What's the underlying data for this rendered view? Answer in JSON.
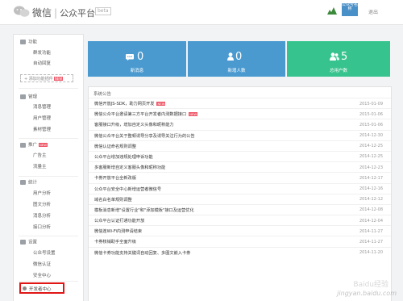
{
  "header": {
    "brand": "微信",
    "platform": "公众平台",
    "beta": "beta",
    "account_name": "公众号名称",
    "logout": "退出"
  },
  "sidebar": {
    "groups": [
      {
        "label": "功能",
        "items": [
          "群发功能",
          "自动回复"
        ]
      },
      {
        "label": "管理",
        "items": [
          "消息管理",
          "用户管理",
          "素材管理"
        ]
      },
      {
        "label": "推广",
        "items": [
          "广告主",
          "流量主"
        ]
      },
      {
        "label": "统计",
        "items": [
          "用户分析",
          "图文分析",
          "消息分析",
          "接口分析"
        ]
      },
      {
        "label": "设置",
        "items": [
          "公众号设置",
          "微信认证",
          "安全中心"
        ]
      }
    ],
    "add_function": "+ 添加功能插件",
    "add_function_badge": "NEW",
    "promo_badge": "NEW",
    "dev_center": "开发者中心"
  },
  "stats": {
    "new_messages": {
      "value": "0",
      "label": "新消息"
    },
    "new_users": {
      "value": "0",
      "label": "新增人数"
    },
    "total_users": {
      "value": "5",
      "label": "总用户数"
    }
  },
  "announcements": {
    "title": "系统公告",
    "items": [
      {
        "text": "微信开放JS-SDK，助力网页开发",
        "new": true,
        "date": "2015-01-09"
      },
      {
        "text": "微信公众平台邀请第三方平台开发者内测数据接口",
        "new": true,
        "date": "2015-01-06"
      },
      {
        "text": "客服接口升级，增加自定义头像和昵称能力",
        "new": false,
        "date": "2015-01-06"
      },
      {
        "text": "微信公众平台关于整顿诱导分享及诱导关注行为的公告",
        "new": false,
        "date": "2014-12-30"
      },
      {
        "text": "微信认证命名规则调整",
        "new": false,
        "date": "2014-12-25"
      },
      {
        "text": "公众平台增加违规处理申诉功能",
        "new": false,
        "date": "2014-12-25"
      },
      {
        "text": "多客服新增自定义客服头像和昵称功能",
        "new": false,
        "date": "2014-12-23"
      },
      {
        "text": "卡券开放平台全新改版",
        "new": false,
        "date": "2014-12-17"
      },
      {
        "text": "公众平台安全中心新增运营者微信号",
        "new": false,
        "date": "2014-12-16"
      },
      {
        "text": "域名白名单规则调整",
        "new": false,
        "date": "2014-12-12"
      },
      {
        "text": "模板消息新增\"设置行业\"和\"添加模板\"接口及运营优化",
        "new": false,
        "date": "2014-12-08"
      },
      {
        "text": "公众平台认证打通功能开放",
        "new": false,
        "date": "2014-12-04"
      },
      {
        "text": "微信连Wi-Fi内测申请结束",
        "new": false,
        "date": "2014-11-27"
      },
      {
        "text": "卡券核销助手全面升级",
        "new": false,
        "date": "2014-11-27"
      },
      {
        "text": "微信卡券功能支持关键词自动回复、多图文嵌入卡券",
        "new": false,
        "date": "2014-11-20"
      }
    ]
  },
  "watermark": "jingyan.baidu.com",
  "watermark2": "Baidu经验"
}
